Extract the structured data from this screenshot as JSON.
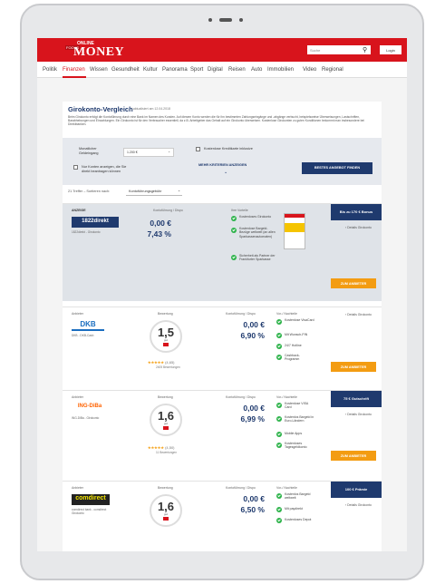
{
  "header": {
    "logo_online": "ONLINE",
    "logo_focus": "FOCUS",
    "logo_money": "MONEY",
    "search_placeholder": "Suche",
    "login": "Login"
  },
  "nav": [
    "Politik",
    "Finanzen",
    "Wissen",
    "Gesundheit",
    "Kultur",
    "Panorama",
    "Sport",
    "Digital",
    "Reisen",
    "Auto",
    "Immobilien",
    "Video",
    "Regional"
  ],
  "nav_active": "Finanzen",
  "page": {
    "title": "Girokonto-Vergleich",
    "updated": "| aktualisiert am 12.04.2018",
    "intro": "Beim Girokonto erfolgt die Kontoführung durch eine Bank im Namen des Kunden. Auf diesem Konto werden die für ihn bestimmten Zahlungseingänge und -abgänge verbucht, beispielsweise Überweisungen, Lastschriften, Barabhebungen und Einzahlungen. Ein Girokonto ist für den Verbraucher essentiell, da z.B. Arbeitgeber das Gehalt auf ein Girokonto überweisen. Kostenlose Girokonten zu guten Konditionen bekommt man insbesondere bei Direktbanken."
  },
  "filter": {
    "income_label": "Monatlicher Geldeingang",
    "income_value": "1.200 €",
    "free_card_label": "Kostenlose Kreditkarte inklusive",
    "local_label": "Nur Konten anzeigen, die Sie direkt beantragen können",
    "more_filter": "MEHR KRITERIEN ANZEIGEN",
    "best_button": "BESTES ANGEBOT FINDEN"
  },
  "results": {
    "count_text": "21 Treffer – Sortieren nach:",
    "sort_value": "Kontoführungsgebühr"
  },
  "columns": {
    "ad_label": "ANZEIGE",
    "provider": "Anbieter",
    "rating": "Bewertung",
    "fee": "Kontoführung / Dispo",
    "pros": "Vor-/ Nachteile",
    "advantages": "Ihre Vorteile"
  },
  "cards": [
    {
      "bank": "1822direkt",
      "product": "1822direkt - Girokonto",
      "fee": "0,00 €",
      "dispo": "7,43 %",
      "bonus": "Bis zu 170 € Bonus",
      "features": [
        "Kostenloses Girokonto",
        "Kostenlose Bargeld-Bezüge weltweit (an allen Sparkassenautomaten)",
        "Sicherheit als Partner der Frankfurter Sparkasse"
      ],
      "details": "› Details Girokonto",
      "cta": "ZUM ANBIETER"
    },
    {
      "bank": "DKB",
      "product": "DKB - DKB-Cash",
      "grade": "1,5",
      "grade_word": "gut",
      "rating": "(4,65)",
      "reviews": "2405 Bewertungen",
      "fee": "0,00 €",
      "dispo": "6,90 %",
      "features": [
        "Kostenlose VisaCard",
        "Mit Wunsch-PIN",
        "24/7 Hotline",
        "Cashback-Programm"
      ],
      "details": "› Details Girokonto",
      "cta": "ZUM ANBIETER"
    },
    {
      "bank": "ING-DiBa",
      "product": "ING-DiBa - Girokonto",
      "grade": "1,6",
      "grade_word": "gut",
      "rating": "(4,50)",
      "reviews": "11 Bewertungen",
      "fee": "0,00 €",
      "dispo": "6,99 %",
      "bonus": "75 € Gutschrift",
      "features": [
        "Kostenlose VISA Card",
        "Kostenlos Bargeld in Euro-Ländern",
        "Mobile Apps",
        "Kostenloses Tagesgeldkonto"
      ],
      "details": "› Details Girokonto",
      "cta": "ZUM ANBIETER"
    },
    {
      "bank": "comdirect",
      "product": "comdirect bank - comdirect Girokonto",
      "grade": "1,6",
      "grade_word": "gut",
      "fee": "0,00 €",
      "dispo": "6,50 %",
      "bonus": "100 € Prämie",
      "features": [
        "Kostenlos Bargeld weltweit",
        "Mit paydirekt",
        "Kostenloses Depot"
      ],
      "details": "› Details Girokonto"
    }
  ],
  "stars": "★★★★★",
  "colors": {
    "brand_red": "#d8141c",
    "navy": "#1f3a6e",
    "orange": "#f39c12",
    "green": "#2db34a"
  }
}
